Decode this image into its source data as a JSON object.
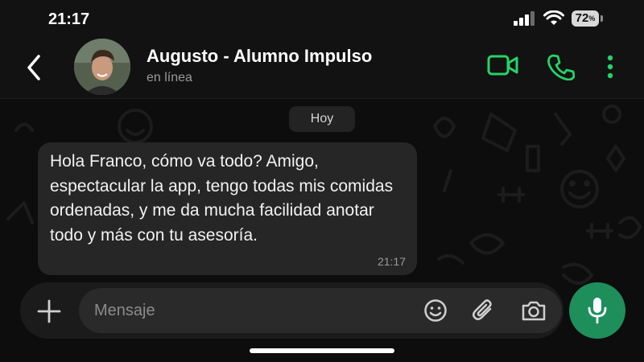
{
  "status_bar": {
    "time": "21:17",
    "battery_level": "72",
    "battery_unit": "%"
  },
  "header": {
    "contact_name": "Augusto - Alumno Impulso",
    "contact_status": "en línea",
    "icons": [
      "back-arrow-icon",
      "video-call-icon",
      "phone-icon",
      "more-options-icon"
    ]
  },
  "chat": {
    "date_label": "Hoy",
    "messages": [
      {
        "direction": "incoming",
        "text": "Hola Franco, cómo va todo? Amigo, espectacular la app, tengo todas mis comidas ordenadas, y me da mucha facilidad anotar todo y más con tu asesoría.",
        "time": "21:17"
      }
    ]
  },
  "composer": {
    "placeholder": "Mensaje",
    "value": "",
    "icons": [
      "plus-icon",
      "sticker-icon",
      "paperclip-icon",
      "camera-icon",
      "microphone-icon"
    ]
  },
  "colors": {
    "accent": "#25d366",
    "mic_button": "#1e8e5b",
    "bubble": "#262626",
    "background": "#0d0d0d"
  }
}
